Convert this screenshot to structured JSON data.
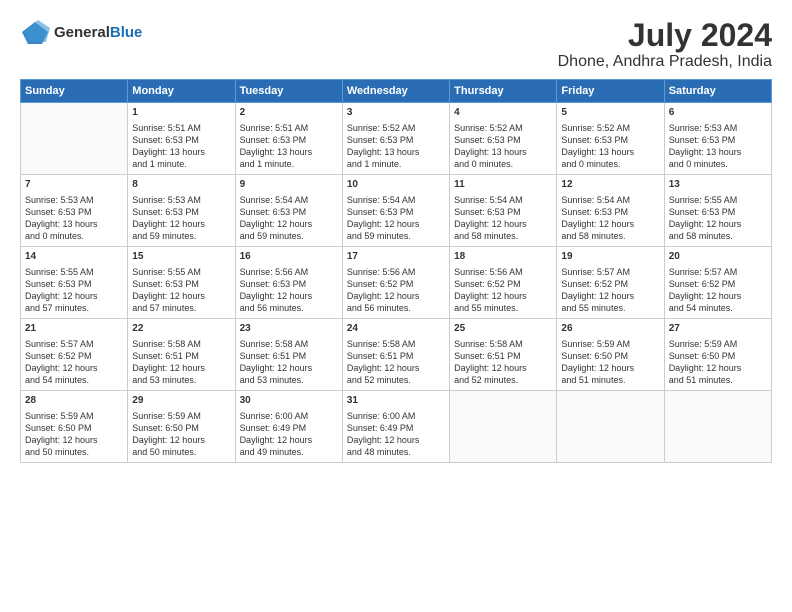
{
  "logo": {
    "general": "General",
    "blue": "Blue"
  },
  "title": "July 2024",
  "subtitle": "Dhone, Andhra Pradesh, India",
  "header_row": [
    "Sunday",
    "Monday",
    "Tuesday",
    "Wednesday",
    "Thursday",
    "Friday",
    "Saturday"
  ],
  "weeks": [
    [
      {
        "day": "",
        "content": ""
      },
      {
        "day": "1",
        "content": "Sunrise: 5:51 AM\nSunset: 6:53 PM\nDaylight: 13 hours\nand 1 minute."
      },
      {
        "day": "2",
        "content": "Sunrise: 5:51 AM\nSunset: 6:53 PM\nDaylight: 13 hours\nand 1 minute."
      },
      {
        "day": "3",
        "content": "Sunrise: 5:52 AM\nSunset: 6:53 PM\nDaylight: 13 hours\nand 1 minute."
      },
      {
        "day": "4",
        "content": "Sunrise: 5:52 AM\nSunset: 6:53 PM\nDaylight: 13 hours\nand 0 minutes."
      },
      {
        "day": "5",
        "content": "Sunrise: 5:52 AM\nSunset: 6:53 PM\nDaylight: 13 hours\nand 0 minutes."
      },
      {
        "day": "6",
        "content": "Sunrise: 5:53 AM\nSunset: 6:53 PM\nDaylight: 13 hours\nand 0 minutes."
      }
    ],
    [
      {
        "day": "7",
        "content": "Sunrise: 5:53 AM\nSunset: 6:53 PM\nDaylight: 13 hours\nand 0 minutes."
      },
      {
        "day": "8",
        "content": "Sunrise: 5:53 AM\nSunset: 6:53 PM\nDaylight: 12 hours\nand 59 minutes."
      },
      {
        "day": "9",
        "content": "Sunrise: 5:54 AM\nSunset: 6:53 PM\nDaylight: 12 hours\nand 59 minutes."
      },
      {
        "day": "10",
        "content": "Sunrise: 5:54 AM\nSunset: 6:53 PM\nDaylight: 12 hours\nand 59 minutes."
      },
      {
        "day": "11",
        "content": "Sunrise: 5:54 AM\nSunset: 6:53 PM\nDaylight: 12 hours\nand 58 minutes."
      },
      {
        "day": "12",
        "content": "Sunrise: 5:54 AM\nSunset: 6:53 PM\nDaylight: 12 hours\nand 58 minutes."
      },
      {
        "day": "13",
        "content": "Sunrise: 5:55 AM\nSunset: 6:53 PM\nDaylight: 12 hours\nand 58 minutes."
      }
    ],
    [
      {
        "day": "14",
        "content": "Sunrise: 5:55 AM\nSunset: 6:53 PM\nDaylight: 12 hours\nand 57 minutes."
      },
      {
        "day": "15",
        "content": "Sunrise: 5:55 AM\nSunset: 6:53 PM\nDaylight: 12 hours\nand 57 minutes."
      },
      {
        "day": "16",
        "content": "Sunrise: 5:56 AM\nSunset: 6:53 PM\nDaylight: 12 hours\nand 56 minutes."
      },
      {
        "day": "17",
        "content": "Sunrise: 5:56 AM\nSunset: 6:52 PM\nDaylight: 12 hours\nand 56 minutes."
      },
      {
        "day": "18",
        "content": "Sunrise: 5:56 AM\nSunset: 6:52 PM\nDaylight: 12 hours\nand 55 minutes."
      },
      {
        "day": "19",
        "content": "Sunrise: 5:57 AM\nSunset: 6:52 PM\nDaylight: 12 hours\nand 55 minutes."
      },
      {
        "day": "20",
        "content": "Sunrise: 5:57 AM\nSunset: 6:52 PM\nDaylight: 12 hours\nand 54 minutes."
      }
    ],
    [
      {
        "day": "21",
        "content": "Sunrise: 5:57 AM\nSunset: 6:52 PM\nDaylight: 12 hours\nand 54 minutes."
      },
      {
        "day": "22",
        "content": "Sunrise: 5:58 AM\nSunset: 6:51 PM\nDaylight: 12 hours\nand 53 minutes."
      },
      {
        "day": "23",
        "content": "Sunrise: 5:58 AM\nSunset: 6:51 PM\nDaylight: 12 hours\nand 53 minutes."
      },
      {
        "day": "24",
        "content": "Sunrise: 5:58 AM\nSunset: 6:51 PM\nDaylight: 12 hours\nand 52 minutes."
      },
      {
        "day": "25",
        "content": "Sunrise: 5:58 AM\nSunset: 6:51 PM\nDaylight: 12 hours\nand 52 minutes."
      },
      {
        "day": "26",
        "content": "Sunrise: 5:59 AM\nSunset: 6:50 PM\nDaylight: 12 hours\nand 51 minutes."
      },
      {
        "day": "27",
        "content": "Sunrise: 5:59 AM\nSunset: 6:50 PM\nDaylight: 12 hours\nand 51 minutes."
      }
    ],
    [
      {
        "day": "28",
        "content": "Sunrise: 5:59 AM\nSunset: 6:50 PM\nDaylight: 12 hours\nand 50 minutes."
      },
      {
        "day": "29",
        "content": "Sunrise: 5:59 AM\nSunset: 6:50 PM\nDaylight: 12 hours\nand 50 minutes."
      },
      {
        "day": "30",
        "content": "Sunrise: 6:00 AM\nSunset: 6:49 PM\nDaylight: 12 hours\nand 49 minutes."
      },
      {
        "day": "31",
        "content": "Sunrise: 6:00 AM\nSunset: 6:49 PM\nDaylight: 12 hours\nand 48 minutes."
      },
      {
        "day": "",
        "content": ""
      },
      {
        "day": "",
        "content": ""
      },
      {
        "day": "",
        "content": ""
      }
    ]
  ]
}
